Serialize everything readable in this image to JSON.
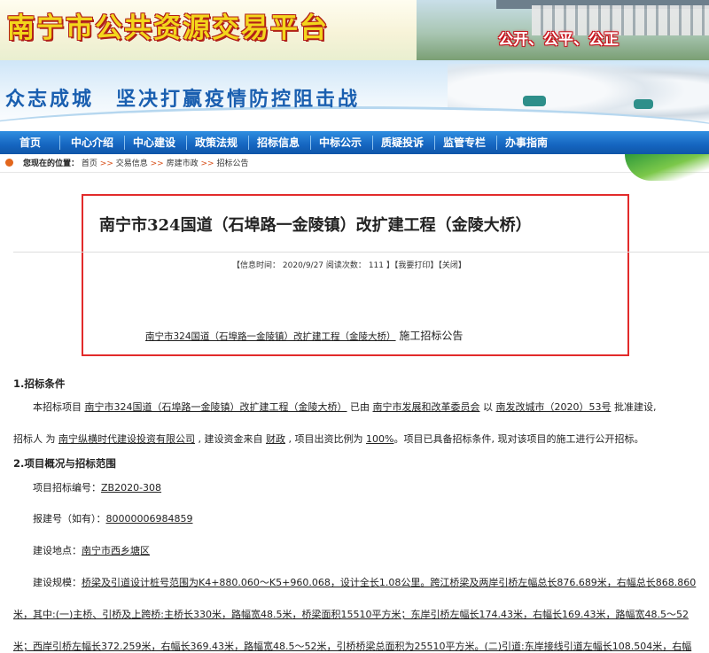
{
  "header": {
    "site_title": "南宁市公共资源交易平台",
    "slogan": "公开、公平、公正",
    "campaign": "众志成城　坚决打赢疫情防控阻击战"
  },
  "nav": {
    "items": [
      "首页",
      "中心介绍",
      "中心建设",
      "政策法规",
      "招标信息",
      "中标公示",
      "质疑投诉",
      "监管专栏",
      "办事指南"
    ]
  },
  "breadcrumb": {
    "label": "您现在的位置：",
    "items": [
      "首页",
      "交易信息",
      "房建市政",
      "招标公告"
    ],
    "sep": ">>"
  },
  "article": {
    "title": "南宁市324国道（石埠路一金陵镇）改扩建工程（金陵大桥）",
    "info_time_label": "【信息时间：",
    "info_time": "2020/9/27",
    "read_label": "阅读次数：",
    "read_count": "111",
    "close_bracket": "】",
    "print": "【我要打印】",
    "close": "【关闭】",
    "subtitle_project": "南宁市324国道（石埠路一金陵镇）改扩建工程（金陵大桥）",
    "subtitle_suffix": " 施工招标公告"
  },
  "content": {
    "sec1_title": "1.招标条件",
    "p1_a": "本招标项目 ",
    "p1_project": "南宁市324国道（石埠路一金陵镇）改扩建工程（金陵大桥）",
    "p1_b": " 已由 ",
    "p1_approver": "南宁市发展和改革委员会",
    "p1_c": " 以 ",
    "p1_doc": "南发改城市（2020）53号",
    "p1_d": " 批准建设,",
    "p2_a": "招标人 为 ",
    "p2_tenderer": "南宁纵横时代建设投资有限公司",
    "p2_b": " , 建设资金来自 ",
    "p2_fund": "财政",
    "p2_c": " , 项目出资比例为 ",
    "p2_ratio": "100%",
    "p2_d": "。项目已具备招标条件, 现对该项目的施工进行公开招标。",
    "sec2_title": "2.项目概况与招标范围",
    "code_label": "项目招标编号：",
    "code": "ZB2020-308",
    "report_label": "报建号（如有）：",
    "report": "80000006984859",
    "site_label": "建设地点：",
    "site": "南宁市西乡塘区",
    "scale_label": "建设规模：",
    "scale_1": "桥梁及引道设计桩号范围为K4+880.060～K5+960.068，设计全长1.08公里。跨江桥梁及两岸引桥左幅总长876.689米，右幅总长868.860",
    "scale_2": "米，其中:(一)主桥、引桥及上跨桥:主桥长330米，路幅宽48.5米，桥梁面积15510平方米；东岸引桥左幅长174.43米，右幅长169.43米，路幅宽48.5～52",
    "scale_3": "米；西岸引桥左幅长372.259米，右幅长369.43米，路幅宽48.5～52米，引桥桥梁总面积为25510平方米。(二)引道:东岸接线引道左幅长108.504米，右幅"
  }
}
